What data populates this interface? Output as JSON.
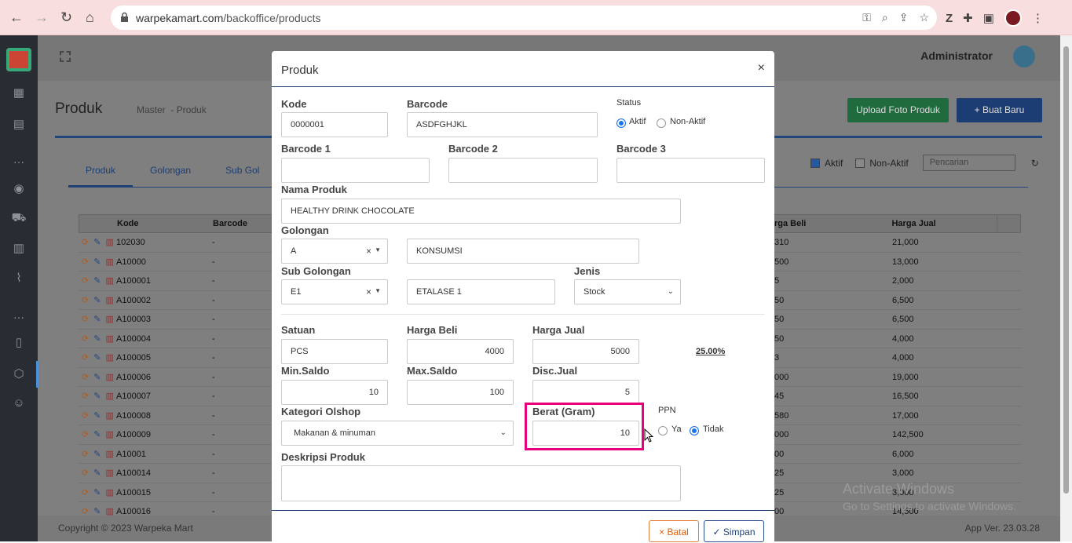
{
  "browser": {
    "url_host": "warpekamart.com",
    "url_path": "/backoffice/products"
  },
  "topbar": {
    "admin_name": "Administrator"
  },
  "page": {
    "title": "Produk",
    "breadcrumb_1": "Master",
    "breadcrumb_2": "- Produk",
    "upload_label": "Upload Foto Produk",
    "new_label": "+ Buat Baru"
  },
  "tabs": [
    "Produk",
    "Golongan",
    "Sub Gol"
  ],
  "filters": {
    "aktif": "Aktif",
    "nonaktif": "Non-Aktif",
    "search_placeholder": "Pencarian"
  },
  "grid": {
    "headers": {
      "kode": "Kode",
      "barcode": "Barcode",
      "harga_beli": "rga Beli",
      "harga_jual": "Harga Jual"
    },
    "rows": [
      {
        "kode": "102030",
        "barcode": "-",
        "beli": "310",
        "jual": "21,000"
      },
      {
        "kode": "A10000",
        "barcode": "-",
        "beli": "500",
        "jual": "13,000"
      },
      {
        "kode": "A100001",
        "barcode": "-",
        "beli": "5",
        "jual": "2,000"
      },
      {
        "kode": "A100002",
        "barcode": "-",
        "beli": "50",
        "jual": "6,500"
      },
      {
        "kode": "A100003",
        "barcode": "-",
        "beli": "50",
        "jual": "6,500"
      },
      {
        "kode": "A100004",
        "barcode": "-",
        "beli": "50",
        "jual": "4,000"
      },
      {
        "kode": "A100005",
        "barcode": "-",
        "beli": "3",
        "jual": "4,000"
      },
      {
        "kode": "A100006",
        "barcode": "-",
        "beli": "000",
        "jual": "19,000"
      },
      {
        "kode": "A100007",
        "barcode": "-",
        "beli": "45",
        "jual": "16,500"
      },
      {
        "kode": "A100008",
        "barcode": "-",
        "beli": "580",
        "jual": "17,000"
      },
      {
        "kode": "A100009",
        "barcode": "-",
        "beli": "000",
        "jual": "142,500"
      },
      {
        "kode": "A10001",
        "barcode": "-",
        "beli": "00",
        "jual": "6,000"
      },
      {
        "kode": "A100014",
        "barcode": "-",
        "beli": "25",
        "jual": "3,000"
      },
      {
        "kode": "A100015",
        "barcode": "-",
        "beli": "25",
        "jual": "3,000"
      },
      {
        "kode": "A100016",
        "barcode": "-",
        "beli": "00",
        "jual": "14,500"
      }
    ]
  },
  "footer": {
    "copyright": "Copyright © 2023 Warpeka Mart",
    "version": "App Ver. 23.03.28"
  },
  "watermark": {
    "line1": "Activate Windows",
    "line2": "Go to Settings to activate Windows."
  },
  "modal": {
    "title": "Produk",
    "close": "×",
    "kode_label": "Kode",
    "kode_value": "0000001",
    "barcode_label": "Barcode",
    "barcode_value": "ASDFGHJKL",
    "status_label": "Status",
    "status_aktif": "Aktif",
    "status_nonaktif": "Non-Aktif",
    "barcode1_label": "Barcode 1",
    "barcode2_label": "Barcode 2",
    "barcode3_label": "Barcode 3",
    "nama_label": "Nama Produk",
    "nama_value": "HEALTHY DRINK CHOCOLATE",
    "golongan_label": "Golongan",
    "golongan_code": "A",
    "golongan_name": "KONSUMSI",
    "subgol_label": "Sub Golongan",
    "subgol_code": "E1",
    "subgol_name": "ETALASE 1",
    "jenis_label": "Jenis",
    "jenis_value": "Stock",
    "satuan_label": "Satuan",
    "satuan_value": "PCS",
    "hbeli_label": "Harga Beli",
    "hbeli_value": "4000",
    "hjual_label": "Harga Jual",
    "hjual_value": "5000",
    "margin": "25.00%",
    "minsaldo_label": "Min.Saldo",
    "minsaldo_value": "10",
    "maxsaldo_label": "Max.Saldo",
    "maxsaldo_value": "100",
    "disc_label": "Disc.Jual",
    "disc_value": "5",
    "kategori_label": "Kategori Olshop",
    "kategori_value": "Makanan & minuman",
    "berat_label": "Berat (Gram)",
    "berat_value": "10",
    "ppn_label": "PPN",
    "ppn_ya": "Ya",
    "ppn_tidak": "Tidak",
    "deskripsi_label": "Deskripsi Produk",
    "batal_label": "× Batal",
    "simpan_label": "✓ Simpan"
  }
}
